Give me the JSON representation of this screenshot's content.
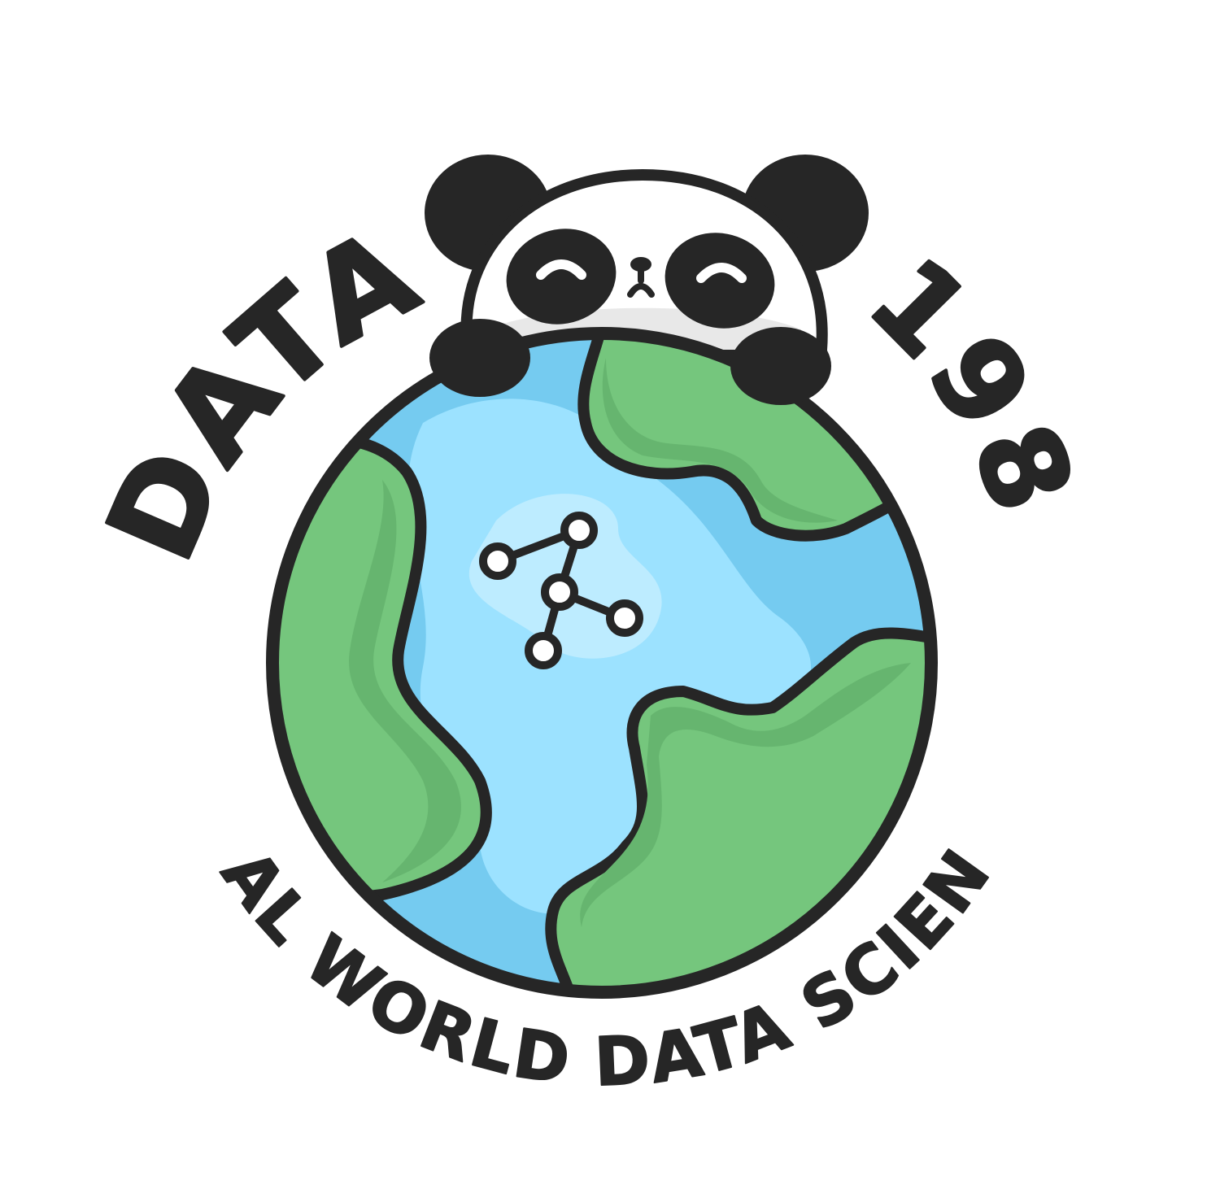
{
  "logo": {
    "top_text_left": "DATA",
    "top_text_right": "198",
    "bottom_text": "REAL WORLD DATA SCIENCE"
  },
  "colors": {
    "background": "#ffffff",
    "outline": "#262626",
    "ocean": "#75cbf0",
    "ocean_light": "#9ce2ff",
    "land": "#75c67d",
    "land_shadow": "#66b56f",
    "panda_face": "#ffffff",
    "panda_chin_shadow": "#e8e8e8"
  },
  "icons": {
    "mascot": "panda-icon",
    "globe": "globe-icon",
    "network": "network-graph-icon"
  }
}
